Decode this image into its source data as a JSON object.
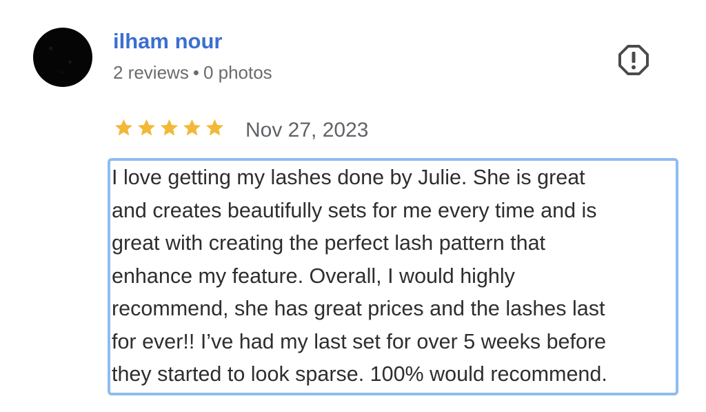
{
  "author": {
    "name": "ilham nour",
    "reviews_count": "2 reviews",
    "separator": "•",
    "photos_count": "0 photos"
  },
  "icons": {
    "avatar": "profile-avatar",
    "report": "report-flag-icon",
    "star": "star-icon"
  },
  "rating": {
    "stars": 5,
    "max": 5,
    "color": "#f2b838"
  },
  "review": {
    "date": "Nov 27, 2023",
    "text": "I love getting my lashes done by Julie. She is great\nand creates beautifully sets for me every time and is\ngreat with creating the perfect lash pattern that\nenhance my feature. Overall, I would highly\nrecommend, she has great prices and the lashes last\nfor ever!! I’ve had my last set for over 5 weeks before\nthey started to look sparse. 100% would recommend."
  },
  "colors": {
    "author_name": "#3b6fd1",
    "meta_text": "#6b6b6b",
    "highlight_border": "#8fbbf0"
  }
}
